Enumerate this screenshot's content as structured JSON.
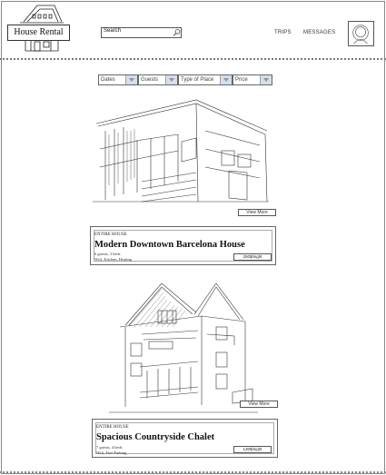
{
  "brand": {
    "name": "House Rental"
  },
  "search": {
    "value": "Search"
  },
  "nav": {
    "trips": "TRIPS",
    "messages": "MESSAGES"
  },
  "filters": [
    "Dates",
    "Guests",
    "Type of Place",
    "Price"
  ],
  "listings": [
    {
      "view_more": "View More",
      "type": "ENTIRE HOUSE",
      "title": "Modern Downtown Barcelona House",
      "guests_beds": "6 guests, 3 beds",
      "amenities": "Wifi, Kitchen, Heating",
      "price": "250$/night"
    },
    {
      "view_more": "View More",
      "type": "ENTIRE HOUSE",
      "title": "Spacious Countryside Chalet",
      "guests_beds": "7 guests, 4 beds",
      "amenities": "Wifi, Free Parking",
      "price": "130$/night"
    }
  ]
}
